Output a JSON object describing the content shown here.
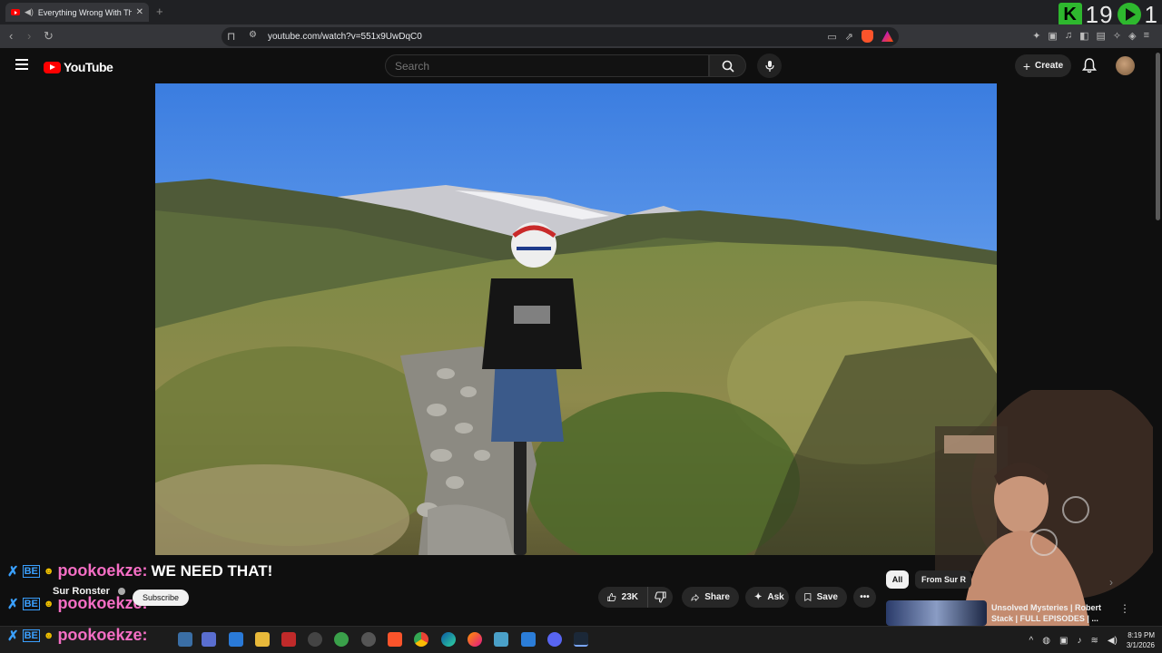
{
  "browser": {
    "tab_title": "Everything Wrong With The F",
    "new_tab": "+",
    "url": "youtube.com/watch?v=551x9UwDqC0",
    "back": "‹",
    "forward": "›",
    "reload": "↻"
  },
  "overlay_counter": {
    "k_label": "K",
    "count_a": "19",
    "count_b": "1"
  },
  "youtube": {
    "logo_text": "YouTube",
    "search_placeholder": "Search",
    "create_label": "Create",
    "create_plus": "+"
  },
  "chat": [
    {
      "user": "pookoekze:",
      "message": "WE NEED THAT!"
    },
    {
      "user": "pookoekze:",
      "message": ""
    },
    {
      "user": "pookoekze:",
      "message": ""
    }
  ],
  "chat_badge": "BE",
  "video_meta": {
    "channel_name": "Sur Ronster",
    "subscribe_label": "Subscribe",
    "like_count": "23K",
    "share_label": "Share",
    "ask_label": "Ask",
    "save_label": "Save",
    "more_label": "•••"
  },
  "sidebar_recs": {
    "chip_all": "All",
    "chip_from": "From Sur R",
    "rec_title": "Unsolved Mysteries | Robert Stack | FULL EPISODES | ..."
  },
  "taskbar": {
    "time": "8:19 PM",
    "date": "3/1/2026",
    "tray_arrow": "^"
  },
  "colors": {
    "accent_red": "#ff0000",
    "chat_username": "#f46ec4",
    "counter_green": "#2eb82e"
  }
}
